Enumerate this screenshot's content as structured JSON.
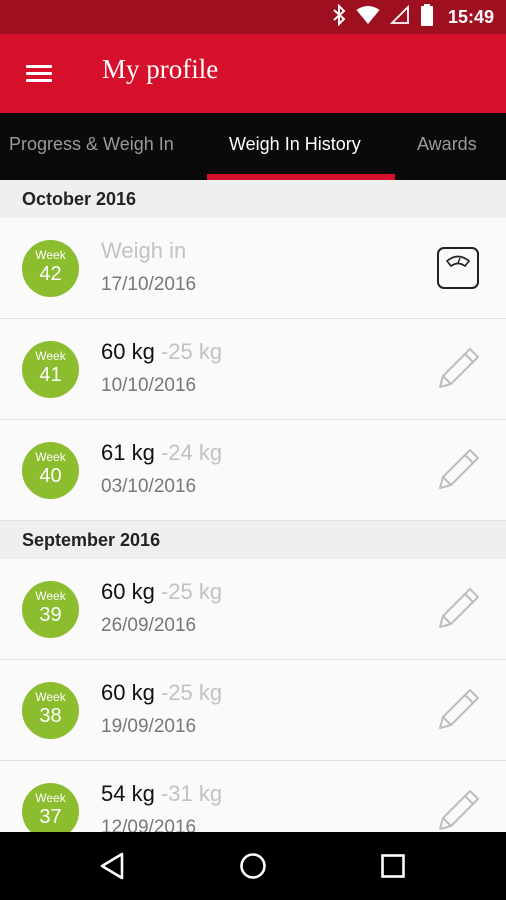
{
  "status_bar": {
    "time": "15:49",
    "icons": [
      "bluetooth-icon",
      "wifi-icon",
      "signal-icon",
      "battery-icon"
    ]
  },
  "app_bar": {
    "title": "My profile",
    "menu_icon": "hamburger-menu-icon"
  },
  "tabs": [
    {
      "label": "Progress & Weigh In",
      "active": false
    },
    {
      "label": "Weigh In History",
      "active": true
    },
    {
      "label": "Awards",
      "active": false
    }
  ],
  "sections": [
    {
      "header": "October 2016",
      "rows": [
        {
          "week_label": "Week",
          "week": "42",
          "main": "Weigh in",
          "change": "",
          "date": "17/10/2016",
          "action_icon": "scale-icon"
        },
        {
          "week_label": "Week",
          "week": "41",
          "main": "60 kg",
          "change": "-25 kg",
          "date": "10/10/2016",
          "action_icon": "edit-pencil-icon"
        },
        {
          "week_label": "Week",
          "week": "40",
          "main": "61 kg",
          "change": "-24 kg",
          "date": "03/10/2016",
          "action_icon": "edit-pencil-icon"
        }
      ]
    },
    {
      "header": "September 2016",
      "rows": [
        {
          "week_label": "Week",
          "week": "39",
          "main": "60 kg",
          "change": "-25 kg",
          "date": "26/09/2016",
          "action_icon": "edit-pencil-icon"
        },
        {
          "week_label": "Week",
          "week": "38",
          "main": "60 kg",
          "change": "-25 kg",
          "date": "19/09/2016",
          "action_icon": "edit-pencil-icon"
        },
        {
          "week_label": "Week",
          "week": "37",
          "main": "54 kg",
          "change": "-31 kg",
          "date": "12/09/2016",
          "action_icon": "edit-pencil-icon"
        }
      ]
    }
  ],
  "nav_bar": {
    "icons": [
      "back-icon",
      "home-icon",
      "recents-icon"
    ]
  },
  "colors": {
    "status_bar": "#9e1020",
    "app_bar": "#d6102a",
    "tab_bar": "#0a0a0a",
    "accent": "#d6102a",
    "week_badge": "#8cbd2f"
  }
}
